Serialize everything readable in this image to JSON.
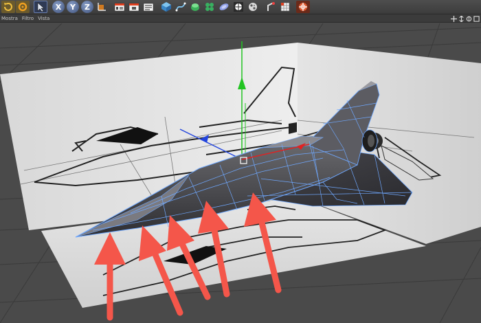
{
  "menubar": {
    "items": [
      "Mostra",
      "Filtro",
      "Vista"
    ]
  },
  "toolbar": {
    "axis_buttons": [
      "X",
      "Y",
      "Z"
    ]
  },
  "colors": {
    "viewport_bg": "#4a4a4a",
    "mesh_wire": "#6fa8ff",
    "axis_y": "#22c422",
    "axis_x": "#e02222",
    "axis_z": "#2244dd",
    "arrow_annotation": "#f4564a"
  },
  "icons": {
    "toolbar": [
      "undo-icon",
      "redo-icon",
      "select-arrow-icon",
      "axis-x-icon",
      "axis-y-icon",
      "axis-z-icon",
      "coordinate-system-icon",
      "render-view-icon",
      "render-picture-viewer-icon",
      "render-settings-icon",
      "cube-primitive-icon",
      "spline-pen-icon",
      "nurbs-icon",
      "array-icon",
      "deformer-icon",
      "scene-icon",
      "environment-icon",
      "camera-light-icon",
      "tag-icon",
      "layout-icon"
    ],
    "view_controls": [
      "move-view-icon",
      "zoom-view-icon",
      "rotate-view-icon",
      "maximize-view-icon"
    ]
  }
}
